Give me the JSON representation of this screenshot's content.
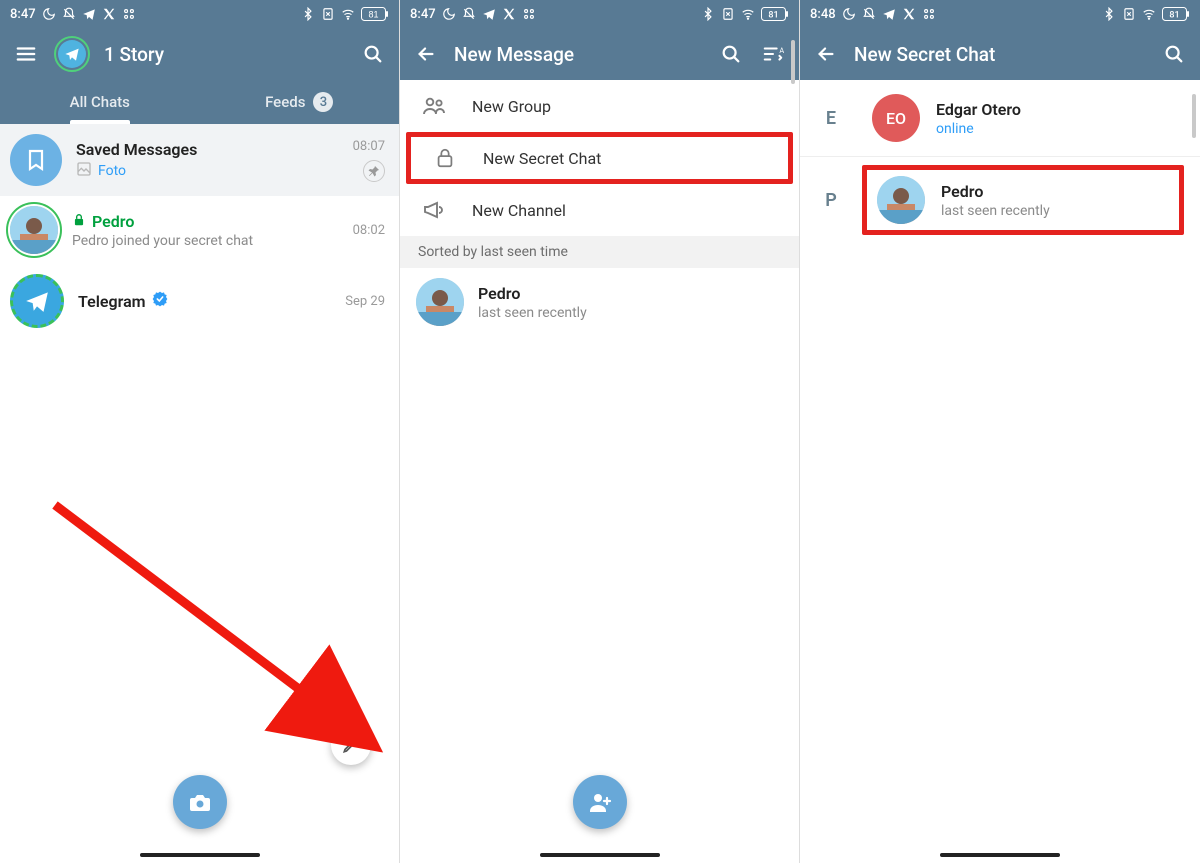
{
  "screen1": {
    "statusbar": {
      "time": "8:47",
      "battery": "81"
    },
    "header": {
      "title": "1 Story"
    },
    "tabs": {
      "allchats": "All Chats",
      "feeds": "Feeds",
      "feeds_count": "3"
    },
    "chats": {
      "saved": {
        "name": "Saved Messages",
        "sub": "Foto",
        "time": "08:07"
      },
      "pedro": {
        "name": "Pedro",
        "sub": "Pedro joined your secret chat",
        "time": "08:02"
      },
      "telegram": {
        "name": "Telegram",
        "time": "Sep 29"
      }
    }
  },
  "screen2": {
    "statusbar": {
      "time": "8:47",
      "battery": "81"
    },
    "header": {
      "title": "New Message"
    },
    "options": {
      "new_group": "New Group",
      "new_secret_chat": "New Secret Chat",
      "new_channel": "New Channel"
    },
    "sort_label": "Sorted by last seen time",
    "contacts": {
      "pedro": {
        "name": "Pedro",
        "status": "last seen recently"
      }
    }
  },
  "screen3": {
    "statusbar": {
      "time": "8:48",
      "battery": "81"
    },
    "header": {
      "title": "New Secret Chat"
    },
    "letters": {
      "e": "E",
      "p": "P"
    },
    "contacts": {
      "edgar": {
        "initials": "EO",
        "name": "Edgar Otero",
        "status": "online"
      },
      "pedro": {
        "name": "Pedro",
        "status": "last seen recently"
      }
    }
  }
}
